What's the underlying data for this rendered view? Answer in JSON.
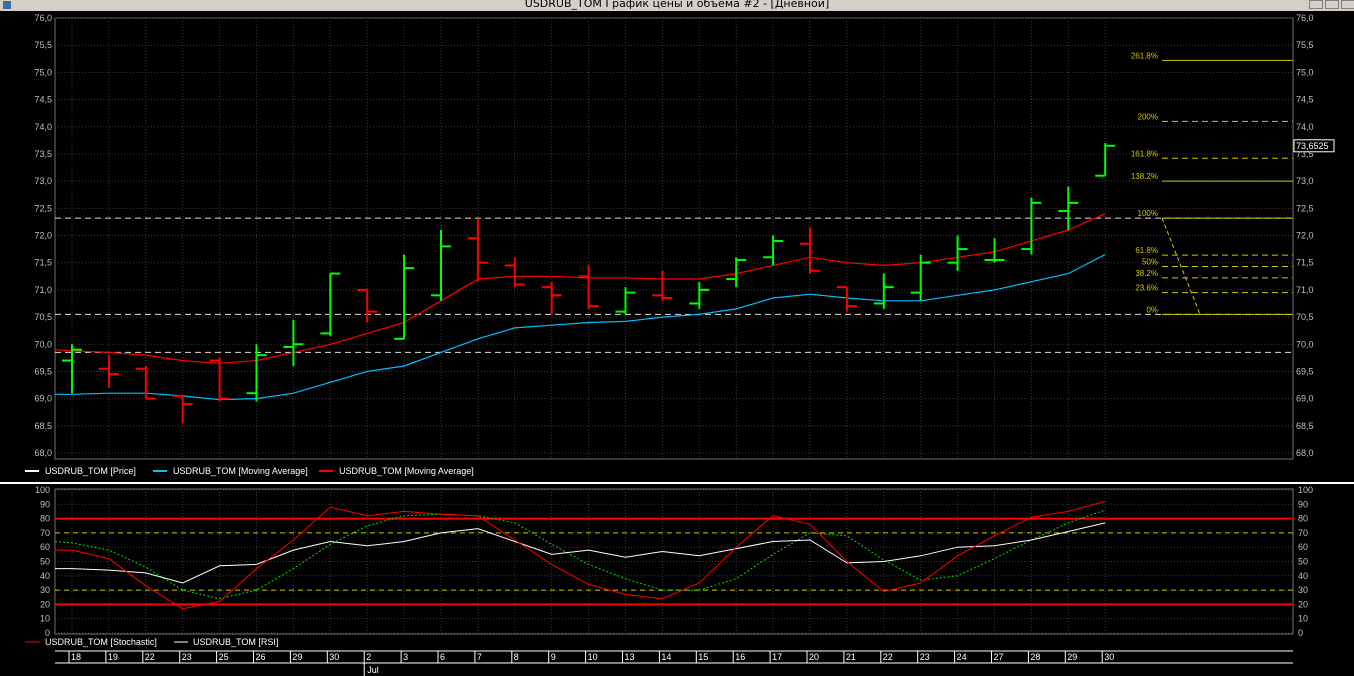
{
  "window": {
    "title": "USDRUB_TOM График цены и объема #2 - [Дневной]"
  },
  "colors": {
    "background": "#000000",
    "grid": "#3c3c3c",
    "axis_text": "#c0c0c0",
    "bar_up": "#00ff00",
    "bar_down": "#ff0000",
    "ma_fast": "#ff0000",
    "ma_slow": "#00c0ff",
    "fib": "#d2c800",
    "level_dash": "#e0e0e0",
    "stoch_line": "#ff0000",
    "stoch_signal": "#00e000",
    "rsi_line": "#ffffff",
    "osc_band": "#ff0000",
    "osc_guide": "#c8c800"
  },
  "chart_data": [
    {
      "type": "ohlc",
      "ylim": [
        68.0,
        76.0
      ],
      "yticks": [
        "68,0",
        "68,5",
        "69,0",
        "69,5",
        "70,0",
        "70,5",
        "71,0",
        "71,5",
        "72,0",
        "72,5",
        "73,0",
        "73,5",
        "74,0",
        "74,5",
        "75,0",
        "75,5",
        "76,0"
      ],
      "x_labels": [
        "18",
        "19",
        "22",
        "23",
        "25",
        "26",
        "29",
        "30",
        "2",
        "3",
        "6",
        "7",
        "8",
        "9",
        "10",
        "13",
        "14",
        "15",
        "16",
        "17",
        "20",
        "21",
        "22",
        "23",
        "24",
        "27",
        "28",
        "29",
        "30"
      ],
      "x_group_label": "Jul",
      "last_price_label": "73,6525",
      "bars": [
        {
          "o": 69.7,
          "h": 70.0,
          "l": 69.1,
          "c": 69.9
        },
        {
          "o": 69.55,
          "h": 69.8,
          "l": 69.2,
          "c": 69.45
        },
        {
          "o": 69.55,
          "h": 69.6,
          "l": 69.0,
          "c": 69.0
        },
        {
          "o": 69.05,
          "h": 69.05,
          "l": 68.55,
          "c": 68.9
        },
        {
          "o": 69.7,
          "h": 69.75,
          "l": 68.95,
          "c": 69.0
        },
        {
          "o": 69.1,
          "h": 70.0,
          "l": 68.95,
          "c": 69.8
        },
        {
          "o": 69.95,
          "h": 70.45,
          "l": 69.6,
          "c": 70.0
        },
        {
          "o": 70.2,
          "h": 71.3,
          "l": 70.15,
          "c": 71.3
        },
        {
          "o": 71.0,
          "h": 71.0,
          "l": 70.4,
          "c": 70.6
        },
        {
          "o": 70.1,
          "h": 71.65,
          "l": 70.1,
          "c": 71.4
        },
        {
          "o": 70.9,
          "h": 72.1,
          "l": 70.8,
          "c": 71.8
        },
        {
          "o": 71.95,
          "h": 72.3,
          "l": 71.15,
          "c": 71.5
        },
        {
          "o": 71.45,
          "h": 71.6,
          "l": 71.05,
          "c": 71.1
        },
        {
          "o": 71.05,
          "h": 71.15,
          "l": 70.55,
          "c": 70.9
        },
        {
          "o": 71.25,
          "h": 71.45,
          "l": 70.65,
          "c": 70.7
        },
        {
          "o": 70.6,
          "h": 71.05,
          "l": 70.55,
          "c": 70.95
        },
        {
          "o": 70.9,
          "h": 71.35,
          "l": 70.8,
          "c": 70.85
        },
        {
          "o": 70.75,
          "h": 71.15,
          "l": 70.65,
          "c": 71.0
        },
        {
          "o": 71.2,
          "h": 71.6,
          "l": 71.05,
          "c": 71.55
        },
        {
          "o": 71.6,
          "h": 72.0,
          "l": 71.45,
          "c": 71.9
        },
        {
          "o": 71.85,
          "h": 72.15,
          "l": 71.3,
          "c": 71.35
        },
        {
          "o": 71.05,
          "h": 71.05,
          "l": 70.6,
          "c": 70.7
        },
        {
          "o": 70.75,
          "h": 71.3,
          "l": 70.65,
          "c": 71.05
        },
        {
          "o": 70.95,
          "h": 71.65,
          "l": 70.8,
          "c": 71.5
        },
        {
          "o": 71.5,
          "h": 72.0,
          "l": 71.35,
          "c": 71.75
        },
        {
          "o": 71.55,
          "h": 71.95,
          "l": 71.5,
          "c": 71.55
        },
        {
          "o": 71.75,
          "h": 72.7,
          "l": 71.65,
          "c": 72.6
        },
        {
          "o": 72.45,
          "h": 72.9,
          "l": 72.1,
          "c": 72.6
        },
        {
          "o": 73.1,
          "h": 73.7,
          "l": 73.1,
          "c": 73.65
        }
      ],
      "ma_fast": [
        69.88,
        69.85,
        69.8,
        69.7,
        69.65,
        69.7,
        69.85,
        70.0,
        70.2,
        70.4,
        70.8,
        71.2,
        71.25,
        71.25,
        71.22,
        71.22,
        71.2,
        71.2,
        71.3,
        71.45,
        71.6,
        71.5,
        71.45,
        71.5,
        71.6,
        71.7,
        71.9,
        72.1,
        72.4
      ],
      "ma_slow": [
        69.08,
        69.1,
        69.1,
        69.05,
        68.98,
        69.0,
        69.1,
        69.3,
        69.5,
        69.6,
        69.85,
        70.1,
        70.3,
        70.35,
        70.4,
        70.42,
        70.5,
        70.55,
        70.65,
        70.85,
        70.92,
        70.85,
        70.8,
        70.8,
        70.9,
        71.0,
        71.15,
        71.3,
        71.65
      ],
      "levels_dashed": [
        72.32,
        70.55,
        69.85
      ],
      "fibonacci": [
        {
          "label": "261.8%",
          "value": 75.22
        },
        {
          "label": "200%",
          "value": 74.1
        },
        {
          "label": "161.8%",
          "value": 73.42
        },
        {
          "label": "138.2%",
          "value": 73.0
        },
        {
          "label": "100%",
          "value": 72.32
        },
        {
          "label": "61.8%",
          "value": 71.64
        },
        {
          "label": "50%",
          "value": 71.43
        },
        {
          "label": "38.2%",
          "value": 71.22
        },
        {
          "label": "23.6%",
          "value": 70.95
        },
        {
          "label": "0%",
          "value": 70.55
        }
      ],
      "legend": [
        {
          "name": "USDRUB_TOM [Price]",
          "color": "#ffffff"
        },
        {
          "name": "USDRUB_TOM [Moving Average]",
          "color": "#00c0ff"
        },
        {
          "name": "USDRUB_TOM [Moving Average]",
          "color": "#ff0000"
        }
      ]
    },
    {
      "type": "line",
      "ylim": [
        0,
        100
      ],
      "yticks": [
        "0",
        "10",
        "20",
        "30",
        "40",
        "50",
        "60",
        "70",
        "80",
        "90",
        "100"
      ],
      "bands": [
        20,
        80
      ],
      "guides": [
        30,
        70
      ],
      "series": [
        {
          "name": "USDRUB_TOM [Stochastic]",
          "values": [
            58,
            52,
            33,
            17,
            22,
            45,
            65,
            88,
            82,
            85,
            83,
            82,
            65,
            48,
            34,
            27,
            24,
            35,
            60,
            82,
            76,
            50,
            29,
            35,
            54,
            68,
            81,
            85,
            92
          ]
        },
        {
          "name": "USDRUB_TOM [RSI]",
          "values": [
            45,
            44,
            42,
            35,
            47,
            48,
            58,
            64,
            61,
            64,
            70,
            73,
            64,
            55,
            58,
            53,
            57,
            54,
            59,
            64,
            65,
            49,
            50,
            54,
            60,
            61,
            65,
            71,
            77
          ]
        },
        {
          "name": "",
          "values": [
            63,
            58,
            46,
            30,
            24,
            30,
            45,
            62,
            75,
            82,
            83,
            82,
            77,
            62,
            48,
            38,
            30,
            30,
            38,
            55,
            70,
            68,
            51,
            37,
            40,
            52,
            65,
            77,
            86
          ]
        }
      ]
    }
  ]
}
